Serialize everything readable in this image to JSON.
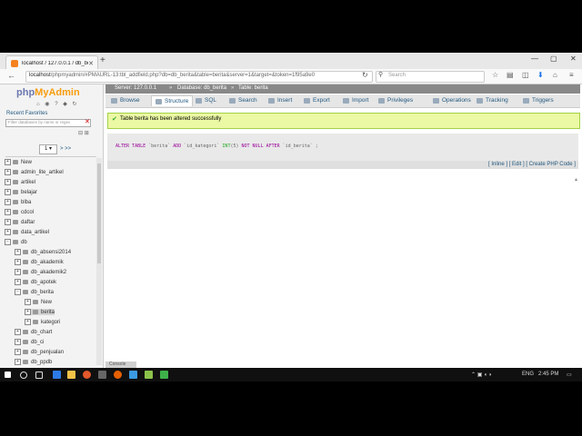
{
  "browser": {
    "tab_title": "localhost / 127.0.0.1 / db_be",
    "url_host": "localhost",
    "url_path": "/phpmyadmin/#PMAURL-13:tbl_addfield.php?db=db_berita&table=berita&server=1&target=&token=1f95a9e0",
    "search_placeholder": "Search"
  },
  "sidebar": {
    "logo_php": "php",
    "logo_mya": "MyAdmin",
    "tabs": "Recent   Favorites",
    "filter_placeholder": "Filter databases by name or regex",
    "page_number": "1",
    "page_nav": "> >>",
    "tree": [
      {
        "label": "New",
        "level": 0,
        "sel": false
      },
      {
        "label": "admin_lite_artikel",
        "level": 0,
        "sel": false
      },
      {
        "label": "artikel",
        "level": 0,
        "sel": false
      },
      {
        "label": "belajar",
        "level": 0,
        "sel": false
      },
      {
        "label": "blba",
        "level": 0,
        "sel": false
      },
      {
        "label": "cdcol",
        "level": 0,
        "sel": false
      },
      {
        "label": "daftar",
        "level": 0,
        "sel": false
      },
      {
        "label": "data_artikel",
        "level": 0,
        "sel": false
      },
      {
        "label": "db",
        "level": 0,
        "sel": false
      },
      {
        "label": "db_absensi2014",
        "level": 1,
        "sel": false
      },
      {
        "label": "db_akademik",
        "level": 1,
        "sel": false
      },
      {
        "label": "db_akademik2",
        "level": 1,
        "sel": false
      },
      {
        "label": "db_apotek",
        "level": 1,
        "sel": false
      },
      {
        "label": "db_berita",
        "level": 1,
        "sel": false
      },
      {
        "label": "New",
        "level": 2,
        "sel": false
      },
      {
        "label": "berita",
        "level": 2,
        "sel": true
      },
      {
        "label": "kategori",
        "level": 2,
        "sel": false
      },
      {
        "label": "db_chart",
        "level": 1,
        "sel": false
      },
      {
        "label": "db_ci",
        "level": 1,
        "sel": false
      },
      {
        "label": "db_penjualan",
        "level": 1,
        "sel": false
      },
      {
        "label": "db_ppdb",
        "level": 1,
        "sel": false
      }
    ]
  },
  "breadcrumb": {
    "server": "Server: 127.0.0.1",
    "database": "Database: db_berita",
    "table": "Table: berita"
  },
  "menu": [
    "Browse",
    "Structure",
    "SQL",
    "Search",
    "Insert",
    "Export",
    "Import",
    "Privileges",
    "Operations",
    "Tracking",
    "Triggers"
  ],
  "message": "Table berita has been altered successfully",
  "sql": {
    "p1": "ALTER TABLE",
    "p2": " `berita` ",
    "p3": "ADD",
    "p4": " `id_kategori` ",
    "p5": "INT",
    "p6": "(5) ",
    "p7": "NOT NULL AFTER",
    "p8": " `id_berita` ;"
  },
  "sql_links": "[ Inline ] [ Edit ] [ Create PHP Code ]",
  "console_label": "Console",
  "taskbar": {
    "lang": "ENG",
    "time": "2:45 PM"
  }
}
